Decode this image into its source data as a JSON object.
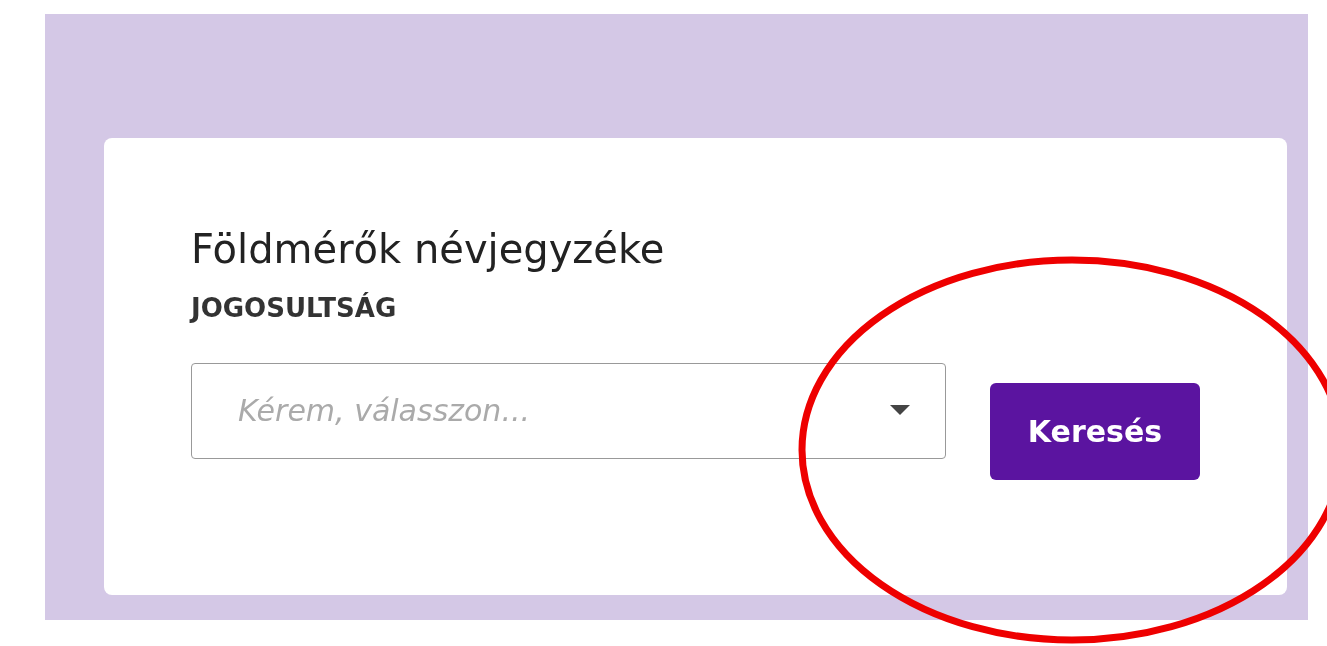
{
  "card": {
    "title": "Földmérők névjegyzéke",
    "field": {
      "label": "JOGOSULTSÁG",
      "placeholder": "Kérem, válasszon..."
    },
    "button": "Keresés"
  }
}
